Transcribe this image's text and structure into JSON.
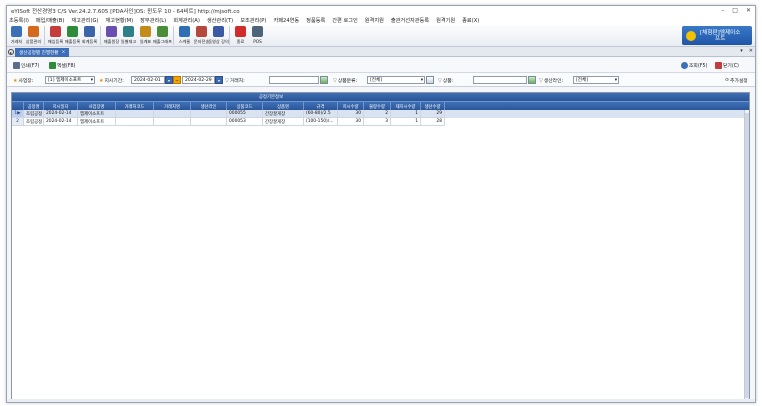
{
  "window": {
    "title": "eYISoft 전산경영3 C/S Ver.24.2.7.605 [PDA사인]OS: 윈도우 10 - 64비트] http://mjsoft.co",
    "minimize": "–",
    "maximize": "□",
    "close": "✕"
  },
  "menu": [
    "초등록(I)",
    "매입/매출(B)",
    "재고관리(G)",
    "재고현황(M)",
    "장부관리(L)",
    "회계관리(A)",
    "생산관리(T)",
    "보조관리(P)",
    "카페24연동",
    "정품등록",
    "간편 로그인",
    "원격지원",
    "출관거선자관등록",
    "원격기원",
    "종료(X)"
  ],
  "toolbar": [
    {
      "label": "거래처",
      "icon": "customer-icon",
      "color": "#3b6fb6"
    },
    {
      "label": "상품관리",
      "icon": "product-icon",
      "color": "#d56a1c"
    },
    {
      "label": "매입등록",
      "icon": "purchase-icon",
      "color": "#c43c3c"
    },
    {
      "label": "매출등록",
      "icon": "sales-icon",
      "color": "#2f8a3a"
    },
    {
      "label": "회계등록",
      "icon": "accounting-icon",
      "color": "#3c64a8"
    },
    {
      "label": "매출원장",
      "icon": "ledger-icon",
      "color": "#6a4fb0"
    },
    {
      "label": "일별재고",
      "icon": "daily-stock-icon",
      "color": "#2e7f86"
    },
    {
      "label": "일계표",
      "icon": "daily-report-icon",
      "color": "#c48b1a"
    },
    {
      "label": "매출그래프",
      "icon": "graph-icon",
      "color": "#4a8e3a"
    },
    {
      "label": "스케줄",
      "icon": "schedule-icon",
      "color": "#2f6fb5"
    },
    {
      "label": "문자전송",
      "icon": "sms-icon",
      "color": "#b5473c"
    },
    {
      "label": "동영상 강의",
      "icon": "video-icon",
      "color": "#3b5aa3"
    },
    {
      "label": "종료",
      "icon": "power-icon",
      "color": "#d12b2b"
    },
    {
      "label": "POS",
      "icon": "pos-icon",
      "color": "#506479"
    }
  ],
  "brand": {
    "line1": "[체험판]엠제이소",
    "line2": "프트"
  },
  "tab": {
    "label": "생산공정별 진행현황",
    "close": "×",
    "tab_close": "✕"
  },
  "actions": {
    "print": "인쇄(F7)",
    "excel": "엑셀(F8)",
    "search": "조회(F5)",
    "close": "닫기(C)"
  },
  "filters": {
    "workplace_label": "사업장:",
    "workplace_value": "[1] 엠제이소프트",
    "period_label": "지시기간:",
    "date_from": "2024-02-01",
    "date_to": "2024-02-29",
    "customer_label": "거래처:",
    "customer_value": "",
    "category_label": "상품분류:",
    "category_value": "[전체]",
    "product_label": "상품:",
    "product_value": "",
    "line_label": "생산라인:",
    "line_value": "[전체]",
    "extra_label": "추가설정"
  },
  "grid": {
    "group_header": "공정기본정보",
    "columns": [
      "",
      "공정명",
      "지시일자",
      "사업장명",
      "거래처코드",
      "거래처명",
      "생산라인",
      "상품코드",
      "상품명",
      "규격",
      "지시수량",
      "불량수량",
      "재지시수량",
      "생산수량"
    ],
    "rows": [
      {
        "rn": "1",
        "marker": "▶",
        "cells": [
          "조립공정",
          "2024-02-14",
          "엠제이소프트",
          "",
          "",
          "",
          "000055",
          "간장꿀게장",
          "(60-80)/2.5",
          "30",
          "2",
          "1",
          "29"
        ]
      },
      {
        "rn": "2",
        "marker": "",
        "cells": [
          "조립공정",
          "2024-02-14",
          "엠제이소프트",
          "",
          "",
          "",
          "000053",
          "간장꿀게장",
          "(100-150)/...",
          "30",
          "3",
          "1",
          "28"
        ]
      }
    ]
  },
  "colors": {
    "header_blue": "#2f5d9f",
    "selected_row": "#d9e3f2",
    "brand_blue": "#1f56a8"
  }
}
